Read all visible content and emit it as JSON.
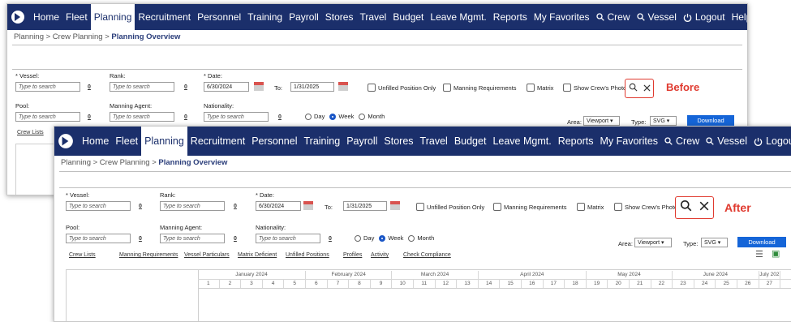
{
  "nav": {
    "items": [
      "Home",
      "Fleet",
      "Planning",
      "Recruitment",
      "Personnel",
      "Training",
      "Payroll",
      "Stores",
      "Travel",
      "Budget",
      "Leave Mgmt.",
      "Reports",
      "My Favorites"
    ],
    "active_index": 2,
    "crew": "Crew",
    "vessel": "Vessel",
    "logout": "Logout",
    "help": "Help"
  },
  "breadcrumb": {
    "part1": "Planning > Crew Planning > ",
    "current": "Planning Overview"
  },
  "filters": {
    "vessel_label": "* Vessel:",
    "rank_label": "Rank:",
    "date_label": "* Date:",
    "pool_label": "Pool:",
    "manning_agent_label": "Manning Agent:",
    "nationality_label": "Nationality:",
    "placeholder": "Type to search",
    "zero": "0",
    "date_from": "6/30/2024",
    "to_label": "To:",
    "date_to": "1/31/2025",
    "unfilled_only": "Unfilled Position Only",
    "manning_requirements": "Manning Requirements",
    "matrix": "Matrix",
    "show_crew_photo": "Show Crew's Photo",
    "view_day": "Day",
    "view_week": "Week",
    "view_month": "Month",
    "area_label": "Area:",
    "area_value": "Viewport",
    "type_label": "Type:",
    "type_value": "SVG",
    "download": "Download"
  },
  "before": {
    "callout": "Before",
    "crew_lists_link": "Crew Lists"
  },
  "after": {
    "callout": "After",
    "links": [
      "Crew Lists",
      "Manning Requirements",
      "Vessel Particulars",
      "Matrix Deficient",
      "Unfilled Positions",
      "Profiles",
      "Activity",
      "Check Compliance"
    ],
    "months": [
      "January 2024",
      "February 2024",
      "March 2024",
      "April 2024",
      "May 2024",
      "June 2024",
      "July 202"
    ],
    "weeks": [
      "1",
      "2",
      "3",
      "4",
      "5",
      "6",
      "7",
      "8",
      "9",
      "10",
      "11",
      "12",
      "13",
      "14",
      "15",
      "16",
      "17",
      "18",
      "19",
      "20",
      "21",
      "22",
      "23",
      "24",
      "25",
      "26",
      "27"
    ]
  }
}
